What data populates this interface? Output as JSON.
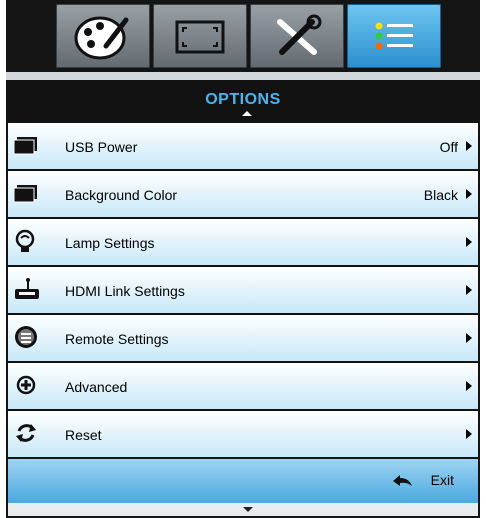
{
  "menu": {
    "tabs": [
      {
        "icon": "image-palette-icon"
      },
      {
        "icon": "display-frame-icon"
      },
      {
        "icon": "tools-icon"
      },
      {
        "icon": "options-list-icon",
        "active": true
      }
    ],
    "title": "OPTIONS",
    "items": [
      {
        "label": "USB Power",
        "value": "Off",
        "icon": "usb-power-icon"
      },
      {
        "label": "Background Color",
        "value": "Black",
        "icon": "background-color-icon"
      },
      {
        "label": "Lamp Settings",
        "value": "",
        "icon": "lamp-icon"
      },
      {
        "label": "HDMI Link Settings",
        "value": "",
        "icon": "hdmi-link-icon"
      },
      {
        "label": "Remote Settings",
        "value": "",
        "icon": "remote-icon"
      },
      {
        "label": "Advanced",
        "value": "",
        "icon": "advanced-plus-icon"
      },
      {
        "label": "Reset",
        "value": "",
        "icon": "reset-arrows-icon"
      }
    ],
    "exit_label": "Exit",
    "colors": {
      "title": "#4ab5ee",
      "active_tab": "#2a8fcf",
      "row_highlight": "#c6e8f7",
      "footer": "#4aa9e0"
    }
  }
}
